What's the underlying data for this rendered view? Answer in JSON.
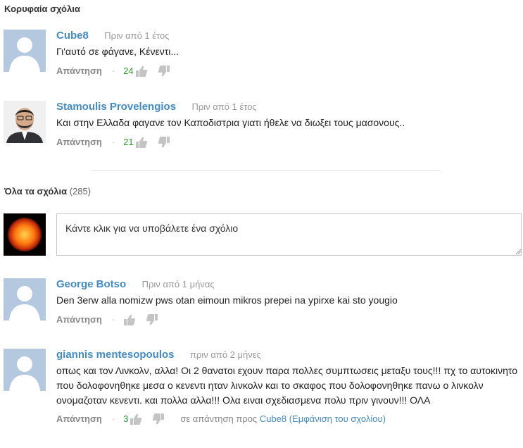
{
  "top_comments": {
    "title": "Κορυφαία σχόλια",
    "items": [
      {
        "author": "Cube8",
        "time": "Πριν από 1 έτος",
        "text": "Γι'αυτό σε φάγανε, Κένεντι...",
        "reply_label": "Απάντηση",
        "votes": "24",
        "avatar": "default-avatar"
      },
      {
        "author": "Stamoulis Provelengios",
        "time": "Πριν από 1 έτος",
        "text": "Και στην Ελλαδα φαγανε τον Καποδιστρια γιατι ήθελε να διωξει τους μασονους..",
        "reply_label": "Απάντηση",
        "votes": "21",
        "avatar": "photo-avatar"
      }
    ]
  },
  "all_comments": {
    "title": "Όλα τα σχόλια",
    "count": "(285)",
    "composer_placeholder": "Κάντε κλικ για να υποβάλετε ένα σχόλιο",
    "items": [
      {
        "author": "George Botso",
        "time": "Πριν από 1 μήνας",
        "text": "Den 3erw alla nomizw pws otan eimoun mikros prepei na ypirxe kai sto yougio",
        "reply_label": "Απάντηση"
      },
      {
        "author": "giannis mentesopoulos",
        "time": "πριν από 2 μήνες",
        "text": "οπως και τον Λινκολν, αλλα! Οι 2 θανατοι εχουν παρα πολλες συμπτωσεις μεταξυ τους!!! πχ το αυτοκινητο που δολοφονηθηκε μεσα ο κενεντι ηταν λινκολν και το σκαφος που δολοφονηθηκε πανω ο λινκολν ονομαζοταν κενεντι. και πολλα αλλα!!! Ολα ειναι σχεδιασμενα πολυ πριν γινουν!!! ΟΛΑ",
        "reply_label": "Απάντηση",
        "votes": "3",
        "reply_to_prefix": "σε απάντηση προς",
        "reply_to_author": "Cube8",
        "reply_to_link": "(Εμφάνιση του σχολίου)"
      }
    ]
  },
  "colors": {
    "author_link": "#438bc5",
    "vote_count": "#2b9d2b",
    "avatar_bg": "#b4c8e0"
  }
}
